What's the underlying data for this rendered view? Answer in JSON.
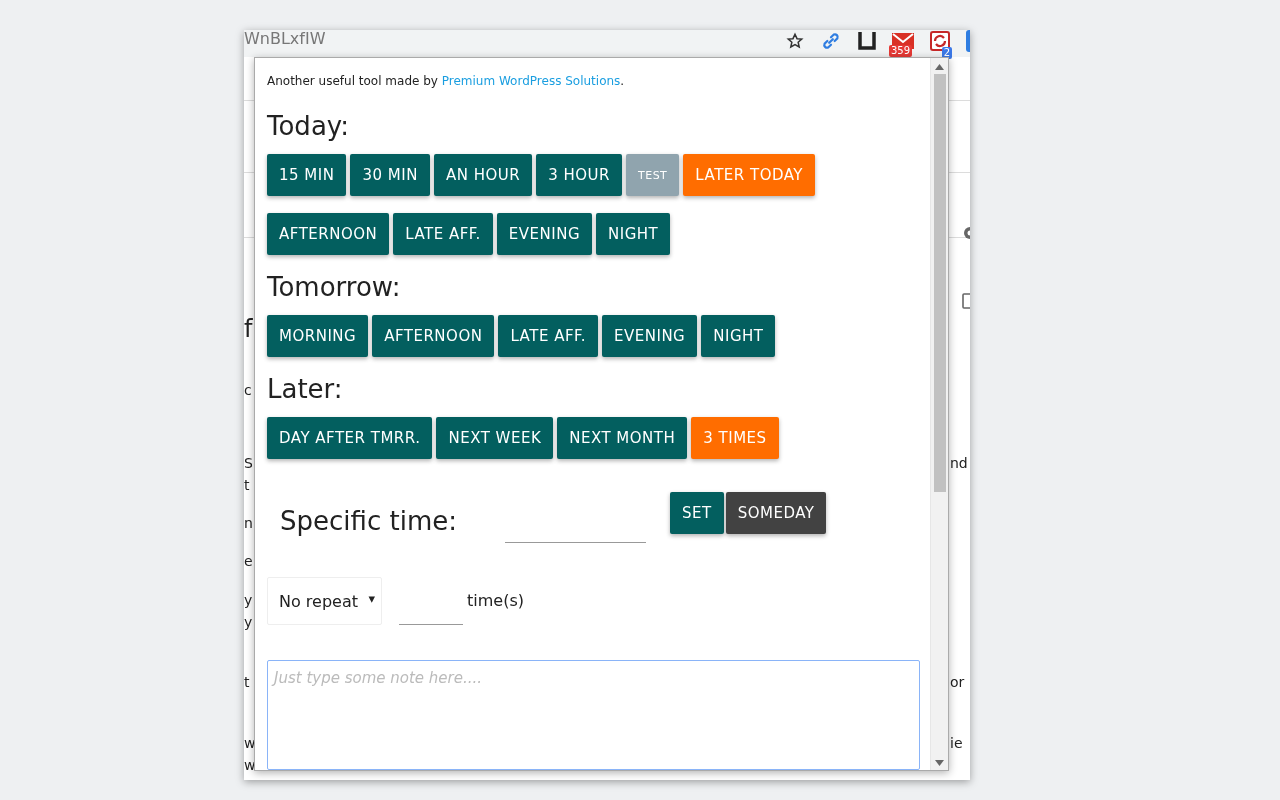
{
  "browser": {
    "url": "WnBLxfIW",
    "mail_badge": "359",
    "extension_badge": "2"
  },
  "background_page": {
    "left_fragments": [
      "f",
      "c",
      "S",
      "t",
      "n",
      "e",
      "y",
      "y",
      "t",
      "w",
      "w"
    ],
    "right_fragments": [
      "nd",
      "or",
      "ie"
    ]
  },
  "popup": {
    "credit": {
      "text": "Another useful tool made by ",
      "link": "Premium WordPress Solutions",
      "after": "."
    },
    "sections": [
      {
        "title": "Today:",
        "buttons": [
          {
            "label": "15 MIN",
            "kind": "primary"
          },
          {
            "label": "30 MIN",
            "kind": "primary"
          },
          {
            "label": "AN HOUR",
            "kind": "primary"
          },
          {
            "label": "3 HOUR",
            "kind": "primary"
          },
          {
            "label": "TEST",
            "kind": "muted"
          },
          {
            "label": "LATER TODAY",
            "kind": "accent"
          },
          {
            "label": "AFTERNOON",
            "kind": "primary"
          },
          {
            "label": "LATE AFF.",
            "kind": "primary"
          },
          {
            "label": "EVENING",
            "kind": "primary"
          },
          {
            "label": "NIGHT",
            "kind": "primary"
          }
        ]
      },
      {
        "title": "Tomorrow:",
        "buttons": [
          {
            "label": "MORNING",
            "kind": "primary"
          },
          {
            "label": "AFTERNOON",
            "kind": "primary"
          },
          {
            "label": "LATE AFF.",
            "kind": "primary"
          },
          {
            "label": "EVENING",
            "kind": "primary"
          },
          {
            "label": "NIGHT",
            "kind": "primary"
          }
        ]
      },
      {
        "title": "Later:",
        "buttons": [
          {
            "label": "DAY AFTER TMRR.",
            "kind": "primary"
          },
          {
            "label": "NEXT WEEK",
            "kind": "primary"
          },
          {
            "label": "NEXT MONTH",
            "kind": "primary"
          },
          {
            "label": "3 TIMES",
            "kind": "accent"
          }
        ]
      }
    ],
    "specific": {
      "label": "Specific time:",
      "buttons": [
        {
          "label": "SET",
          "kind": "primary"
        },
        {
          "label": "SOMEDAY",
          "kind": "dark"
        }
      ]
    },
    "repeat": {
      "select": "No repeat",
      "arrow": "▾",
      "unit": "time(s)"
    },
    "note": {
      "placeholder": "Just type some note here...."
    }
  }
}
